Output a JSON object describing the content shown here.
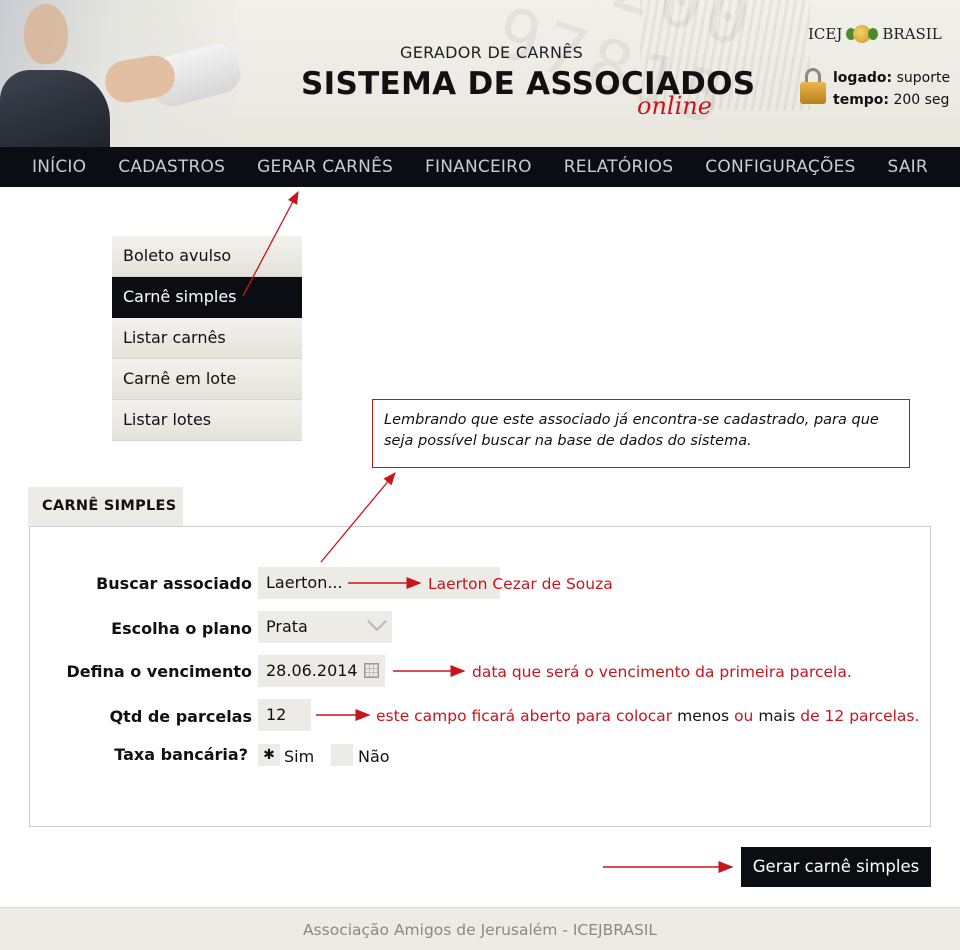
{
  "header": {
    "subtitle": "GERADOR DE CARNÊS",
    "title": "SISTEMA DE ASSOCIADOS",
    "title_accent": "online",
    "brand_left": "ICEJ",
    "brand_right": "BRASIL",
    "session": {
      "user_label": "logado:",
      "user_value": "suporte",
      "time_label": "tempo:",
      "time_value": "200 seg"
    }
  },
  "nav": {
    "items": [
      "INÍCIO",
      "CADASTROS",
      "GERAR CARNÊS",
      "FINANCEIRO",
      "RELATÓRIOS",
      "CONFIGURAÇÕES",
      "SAIR"
    ]
  },
  "submenu": {
    "items": [
      "Boleto avulso",
      "Carnê simples",
      "Listar carnês",
      "Carnê em lote",
      "Listar lotes"
    ],
    "active": "Carnê simples"
  },
  "note": "Lembrando que este associado já encontra-se cadastrado, para que seja possível buscar na base de dados do sistema.",
  "form": {
    "tab_label": "CARNÊ SIMPLES",
    "search": {
      "label": "Buscar associado",
      "value": "Laerton...",
      "annotation": "Laerton Cezar de Souza"
    },
    "plan": {
      "label": "Escolha o plano",
      "value": "Prata"
    },
    "due_date": {
      "label": "Defina o vencimento",
      "value": "28.06.2014",
      "annotation": "data que será o vencimento da primeira parcela."
    },
    "installments": {
      "label": "Qtd de parcelas",
      "value": "12",
      "annotation_parts": [
        "este campo ficará aberto para colocar",
        "menos",
        "ou",
        "mais",
        "de 12 parcelas."
      ]
    },
    "bank_fee": {
      "label": "Taxa bancária?",
      "options": [
        "Sim",
        "Não"
      ],
      "selected": "Sim",
      "mark": "✱"
    }
  },
  "submit_label": "Gerar carnê simples",
  "footer": "Associação Amigos de Jerusalém - ICEJBRASIL",
  "colors": {
    "accent_red": "#c8151b",
    "nav_bg": "#0c0d12",
    "field_bg": "#ecebe5"
  }
}
